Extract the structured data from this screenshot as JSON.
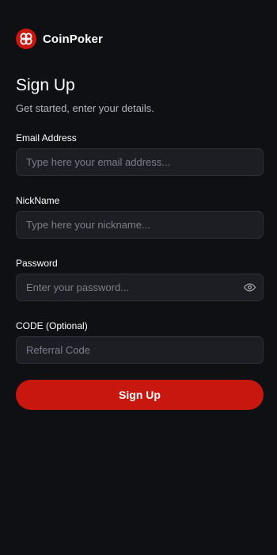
{
  "brand": {
    "name": "CoinPoker",
    "logo_icon": "coinpoker-logo-icon",
    "accent": "#c8170f"
  },
  "header": {
    "title": "Sign Up",
    "subtitle": "Get started, enter your details."
  },
  "form": {
    "email": {
      "label": "Email Address",
      "placeholder": "Type here your email address..."
    },
    "nickname": {
      "label": "NickName",
      "placeholder": "Type here your nickname..."
    },
    "password": {
      "label": "Password",
      "placeholder": "Enter your password...",
      "toggle_icon": "eye-icon"
    },
    "code": {
      "label": "CODE (Optional)",
      "placeholder": "Referral Code"
    },
    "submit_label": "Sign Up"
  }
}
